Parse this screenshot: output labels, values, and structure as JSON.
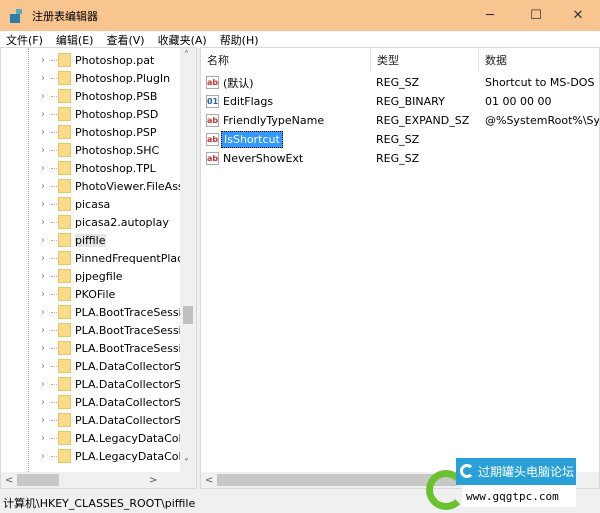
{
  "window": {
    "title": "注册表编辑器",
    "minimize": "─",
    "maximize": "☐",
    "close": "✕"
  },
  "menu": [
    "文件(F)",
    "编辑(E)",
    "查看(V)",
    "收藏夹(A)",
    "帮助(H)"
  ],
  "tree": {
    "items": [
      "Photoshop.pat",
      "Photoshop.PlugIn",
      "Photoshop.PSB",
      "Photoshop.PSD",
      "Photoshop.PSP",
      "Photoshop.SHC",
      "Photoshop.TPL",
      "PhotoViewer.FileAss",
      "picasa",
      "picasa2.autoplay",
      "piffile",
      "PinnedFrequentPlac",
      "pjpegfile",
      "PKOFile",
      "PLA.BootTraceSessi",
      "PLA.BootTraceSessi",
      "PLA.BootTraceSessi",
      "PLA.DataCollectorSe",
      "PLA.DataCollectorSe",
      "PLA.DataCollectorSe",
      "PLA.DataCollectorSe",
      "PLA.LegacyDataColl",
      "PLA.LegacyDataColl"
    ],
    "selected": "piffile"
  },
  "list": {
    "columns": [
      "名称",
      "类型",
      "数据"
    ],
    "rows": [
      {
        "name": "(默认)",
        "type": "REG_SZ",
        "data": "Shortcut to MS-DOS P",
        "icon": "string-value-icon"
      },
      {
        "name": "EditFlags",
        "type": "REG_BINARY",
        "data": "01 00 00 00",
        "icon": "binary-value-icon"
      },
      {
        "name": "FriendlyTypeName",
        "type": "REG_EXPAND_SZ",
        "data": "@%SystemRoot%\\Sys",
        "icon": "string-value-icon"
      },
      {
        "name": "IsShortcut",
        "type": "REG_SZ",
        "data": "",
        "icon": "string-value-icon"
      },
      {
        "name": "NeverShowExt",
        "type": "REG_SZ",
        "data": "",
        "icon": "string-value-icon"
      }
    ],
    "selected": "IsShortcut"
  },
  "status": "计算机\\HKEY_CLASSES_ROOT\\piffile",
  "watermark": {
    "name": "过期罐头电脑论坛",
    "url": "www.gqgtpc.com"
  },
  "colors": {
    "titlebar": "#f8c48f",
    "selection": "#3399ff",
    "folder": "#f8dc8a"
  }
}
